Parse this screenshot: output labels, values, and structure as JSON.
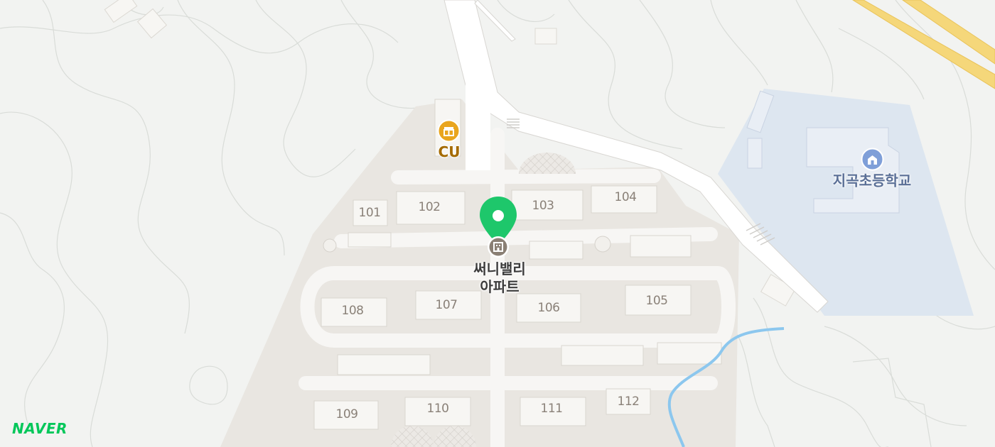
{
  "map": {
    "provider_logo": "NAVER",
    "selected_place": {
      "name_line1": "써니밸리",
      "name_line2": "아파트",
      "marker_icon": "location-pin-icon",
      "category_icon": "apartment-icon"
    },
    "pois": [
      {
        "id": "cu",
        "label": "CU",
        "icon": "convenience-store-icon",
        "color": "#e9a51e"
      },
      {
        "id": "school",
        "label": "지곡초등학교",
        "icon": "school-icon",
        "color": "#7f9fd8"
      }
    ],
    "buildings": [
      "101",
      "102",
      "103",
      "104",
      "105",
      "106",
      "107",
      "108",
      "109",
      "110",
      "111",
      "112"
    ],
    "colors": {
      "background": "#f2f3f1",
      "complex": "#e9e6e1",
      "building": "#f7f6f3",
      "road": "#ffffff",
      "school_area": "#dde6f0",
      "stream": "#8cc7ee",
      "highway": "#f5d77a",
      "marker": "#1ec76b"
    }
  }
}
